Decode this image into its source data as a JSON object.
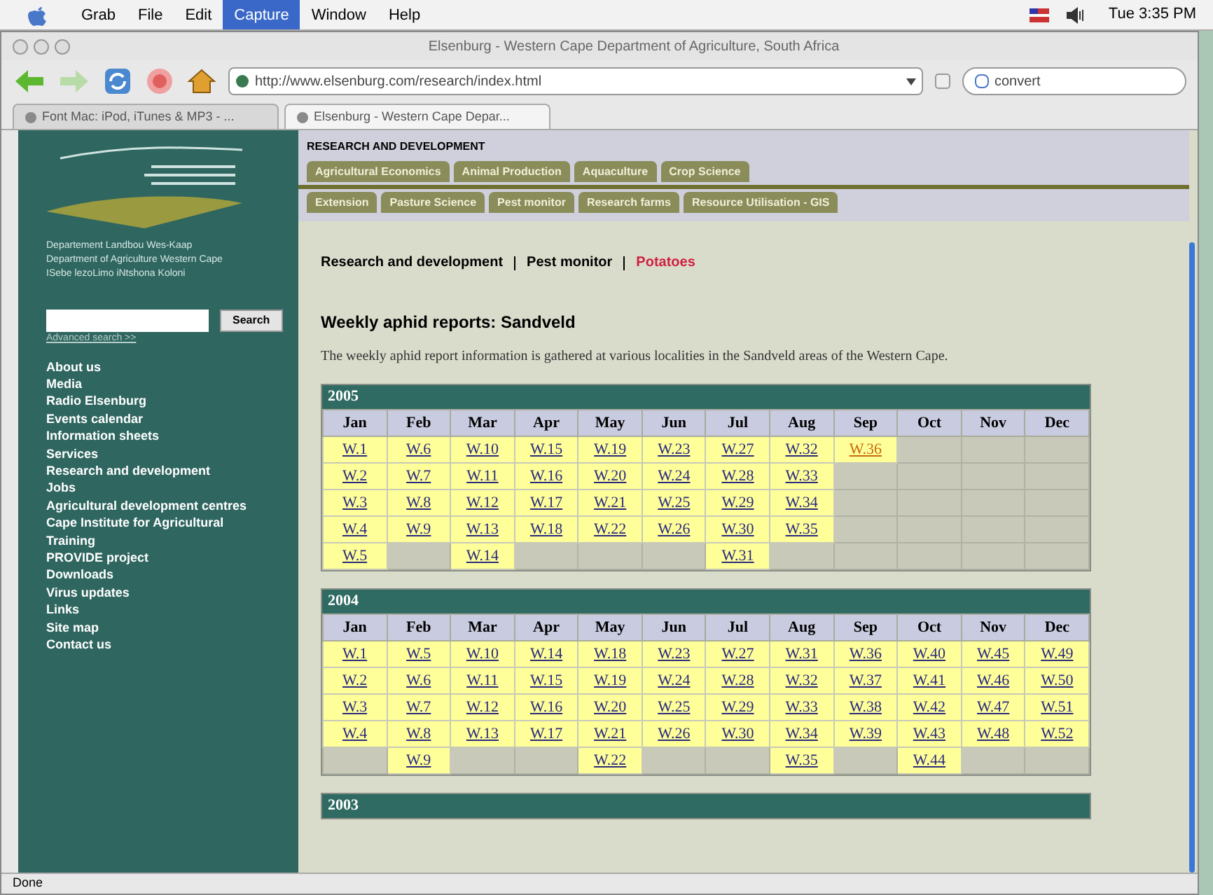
{
  "menubar": {
    "items": [
      {
        "label": "Grab",
        "selected": false
      },
      {
        "label": "File",
        "selected": false
      },
      {
        "label": "Edit",
        "selected": false
      },
      {
        "label": "Capture",
        "selected": true
      },
      {
        "label": "Window",
        "selected": false
      },
      {
        "label": "Help",
        "selected": false
      }
    ],
    "clock": "Tue 3:35 PM"
  },
  "window": {
    "title": "Elsenburg - Western Cape Department of Agriculture, South Africa"
  },
  "toolbar": {
    "url": "http://www.elsenburg.com/research/index.html",
    "search": "convert"
  },
  "browser_tabs": [
    {
      "label": "Font Mac: iPod, iTunes & MP3 - ...",
      "selected": false
    },
    {
      "label": "Elsenburg - Western Cape Depar...",
      "selected": true
    }
  ],
  "sidebar": {
    "logo_lines": [
      "Departement Landbou Wes-Kaap",
      "Department of Agriculture Western Cape",
      "ISebe lezoLimo iNtshona Koloni"
    ],
    "search_button": "Search",
    "advanced_link": "Advanced search >>",
    "items": [
      "About us",
      "Media",
      "Radio Elsenburg",
      "Events calendar",
      "Information sheets",
      "Services",
      "Research and development",
      "Jobs",
      "Agricultural development centres",
      "Cape Institute for Agricultural Training",
      "PROVIDE project",
      "Downloads",
      "Virus updates",
      "Links",
      "Site map",
      "Contact us"
    ]
  },
  "section_title": "RESEARCH AND DEVELOPMENT",
  "section_tabs": [
    [
      "Agricultural Economics",
      "Animal Production",
      "Aquaculture",
      "Crop Science"
    ],
    [
      "Extension",
      "Pasture Science",
      "Pest monitor",
      "Research farms",
      "Resource Utilisation - GIS"
    ]
  ],
  "breadcrumb": [
    {
      "label": "Research and development",
      "current": false
    },
    {
      "label": "Pest monitor",
      "current": false
    },
    {
      "label": "Potatoes",
      "current": true
    }
  ],
  "heading": "Weekly aphid reports: Sandveld",
  "intro": "The weekly aphid report information is gathered at various localities in the Sandveld areas of the Western Cape.",
  "tables": [
    {
      "year": "2005",
      "months": [
        {
          "month": "Jan",
          "weeks": [
            {
              "label": "W.1",
              "latest": false
            },
            {
              "label": "W.2",
              "latest": false
            },
            {
              "label": "W.3",
              "latest": false
            },
            {
              "label": "W.4",
              "latest": false
            },
            {
              "label": "W.5",
              "latest": false
            }
          ]
        },
        {
          "month": "Feb",
          "weeks": [
            {
              "label": "W.6",
              "latest": false
            },
            {
              "label": "W.7",
              "latest": false
            },
            {
              "label": "W.8",
              "latest": false
            },
            {
              "label": "W.9",
              "latest": false
            }
          ]
        },
        {
          "month": "Mar",
          "weeks": [
            {
              "label": "W.10",
              "latest": false
            },
            {
              "label": "W.11",
              "latest": false
            },
            {
              "label": "W.12",
              "latest": false
            },
            {
              "label": "W.13",
              "latest": false
            },
            {
              "label": "W.14",
              "latest": false
            }
          ]
        },
        {
          "month": "Apr",
          "weeks": [
            {
              "label": "W.15",
              "latest": false
            },
            {
              "label": "W.16",
              "latest": false
            },
            {
              "label": "W.17",
              "latest": false
            },
            {
              "label": "W.18",
              "latest": false
            }
          ]
        },
        {
          "month": "May",
          "weeks": [
            {
              "label": "W.19",
              "latest": false
            },
            {
              "label": "W.20",
              "latest": false
            },
            {
              "label": "W.21",
              "latest": false
            },
            {
              "label": "W.22",
              "latest": false
            }
          ]
        },
        {
          "month": "Jun",
          "weeks": [
            {
              "label": "W.23",
              "latest": false
            },
            {
              "label": "W.24",
              "latest": false
            },
            {
              "label": "W.25",
              "latest": false
            },
            {
              "label": "W.26",
              "latest": false
            }
          ]
        },
        {
          "month": "Jul",
          "weeks": [
            {
              "label": "W.27",
              "latest": false
            },
            {
              "label": "W.28",
              "latest": false
            },
            {
              "label": "W.29",
              "latest": false
            },
            {
              "label": "W.30",
              "latest": false
            },
            {
              "label": "W.31",
              "latest": false
            }
          ]
        },
        {
          "month": "Aug",
          "weeks": [
            {
              "label": "W.32",
              "latest": false
            },
            {
              "label": "W.33",
              "latest": false
            },
            {
              "label": "W.34",
              "latest": false
            },
            {
              "label": "W.35",
              "latest": false
            }
          ]
        },
        {
          "month": "Sep",
          "weeks": [
            {
              "label": "W.36",
              "latest": true
            }
          ]
        },
        {
          "month": "Oct"
        },
        {
          "month": "Nov"
        },
        {
          "month": "Dec"
        }
      ]
    },
    {
      "year": "2004",
      "months": [
        {
          "month": "Jan",
          "weeks": [
            {
              "label": "W.1",
              "latest": false
            },
            {
              "label": "W.2",
              "latest": false
            },
            {
              "label": "W.3",
              "latest": false
            },
            {
              "label": "W.4",
              "latest": false
            }
          ]
        },
        {
          "month": "Feb",
          "weeks": [
            {
              "label": "W.5",
              "latest": false
            },
            {
              "label": "W.6",
              "latest": false
            },
            {
              "label": "W.7",
              "latest": false
            },
            {
              "label": "W.8",
              "latest": false
            },
            {
              "label": "W.9",
              "latest": false
            }
          ]
        },
        {
          "month": "Mar",
          "weeks": [
            {
              "label": "W.10",
              "latest": false
            },
            {
              "label": "W.11",
              "latest": false
            },
            {
              "label": "W.12",
              "latest": false
            },
            {
              "label": "W.13",
              "latest": false
            }
          ]
        },
        {
          "month": "Apr",
          "weeks": [
            {
              "label": "W.14",
              "latest": false
            },
            {
              "label": "W.15",
              "latest": false
            },
            {
              "label": "W.16",
              "latest": false
            },
            {
              "label": "W.17",
              "latest": false
            }
          ]
        },
        {
          "month": "May",
          "weeks": [
            {
              "label": "W.18",
              "latest": false
            },
            {
              "label": "W.19",
              "latest": false
            },
            {
              "label": "W.20",
              "latest": false
            },
            {
              "label": "W.21",
              "latest": false
            },
            {
              "label": "W.22",
              "latest": false
            }
          ]
        },
        {
          "month": "Jun",
          "weeks": [
            {
              "label": "W.23",
              "latest": false
            },
            {
              "label": "W.24",
              "latest": false
            },
            {
              "label": "W.25",
              "latest": false
            },
            {
              "label": "W.26",
              "latest": false
            }
          ]
        },
        {
          "month": "Jul",
          "weeks": [
            {
              "label": "W.27",
              "latest": false
            },
            {
              "label": "W.28",
              "latest": false
            },
            {
              "label": "W.29",
              "latest": false
            },
            {
              "label": "W.30",
              "latest": false
            }
          ]
        },
        {
          "month": "Aug",
          "weeks": [
            {
              "label": "W.31",
              "latest": false
            },
            {
              "label": "W.32",
              "latest": false
            },
            {
              "label": "W.33",
              "latest": false
            },
            {
              "label": "W.34",
              "latest": false
            },
            {
              "label": "W.35",
              "latest": false
            }
          ]
        },
        {
          "month": "Sep",
          "weeks": [
            {
              "label": "W.36",
              "latest": false
            },
            {
              "label": "W.37",
              "latest": false
            },
            {
              "label": "W.38",
              "latest": false
            },
            {
              "label": "W.39",
              "latest": false
            }
          ]
        },
        {
          "month": "Oct",
          "weeks": [
            {
              "label": "W.40",
              "latest": false
            },
            {
              "label": "W.41",
              "latest": false
            },
            {
              "label": "W.42",
              "latest": false
            },
            {
              "label": "W.43",
              "latest": false
            },
            {
              "label": "W.44",
              "latest": false
            }
          ]
        },
        {
          "month": "Nov",
          "weeks": [
            {
              "label": "W.45",
              "latest": false
            },
            {
              "label": "W.46",
              "latest": false
            },
            {
              "label": "W.47",
              "latest": false
            },
            {
              "label": "W.48",
              "latest": false
            }
          ]
        },
        {
          "month": "Dec",
          "weeks": [
            {
              "label": "W.49",
              "latest": false
            },
            {
              "label": "W.50",
              "latest": false
            },
            {
              "label": "W.51",
              "latest": false
            },
            {
              "label": "W.52",
              "latest": false
            }
          ]
        }
      ]
    },
    {
      "year": "2003"
    }
  ],
  "status_bar": "Done"
}
